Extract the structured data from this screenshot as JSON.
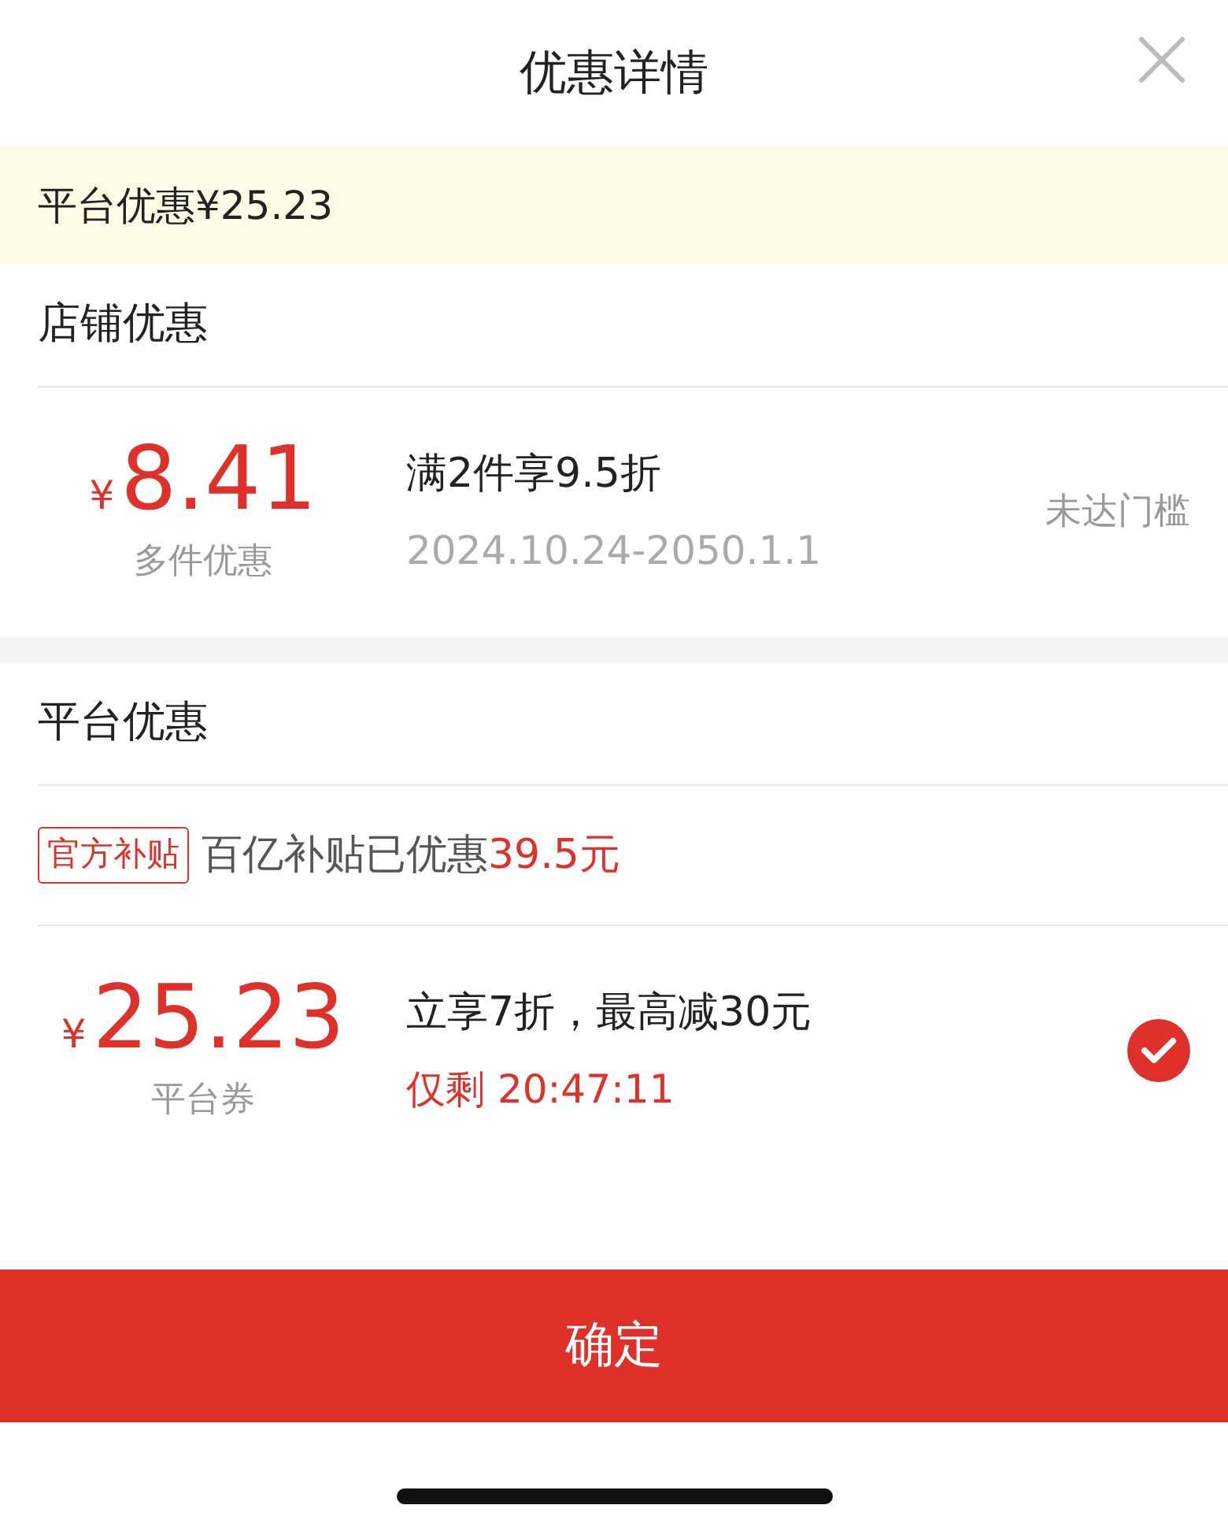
{
  "header": {
    "title": "优惠详情"
  },
  "banner": {
    "label": "平台优惠",
    "amount": "¥25.23"
  },
  "sections": [
    {
      "heading": "店铺优惠",
      "coupons": [
        {
          "kind": "date",
          "currency": "¥",
          "amount": "8.41",
          "label": "多件优惠",
          "title": "满2件享9.5折",
          "detail": "2024.10.24-2050.1.1",
          "status": "未达门槛"
        }
      ]
    },
    {
      "heading": "平台优惠",
      "subsidy": {
        "tag": "官方补贴",
        "text": "百亿补贴已优惠",
        "amount": "39.5元"
      },
      "coupons": [
        {
          "kind": "countdown",
          "currency": "¥",
          "amount": "25.23",
          "label": "平台券",
          "title": "立享7折，最高减30元",
          "detail": "仅剩 20:47:11",
          "selected": true
        }
      ]
    }
  ],
  "confirm": "确定"
}
